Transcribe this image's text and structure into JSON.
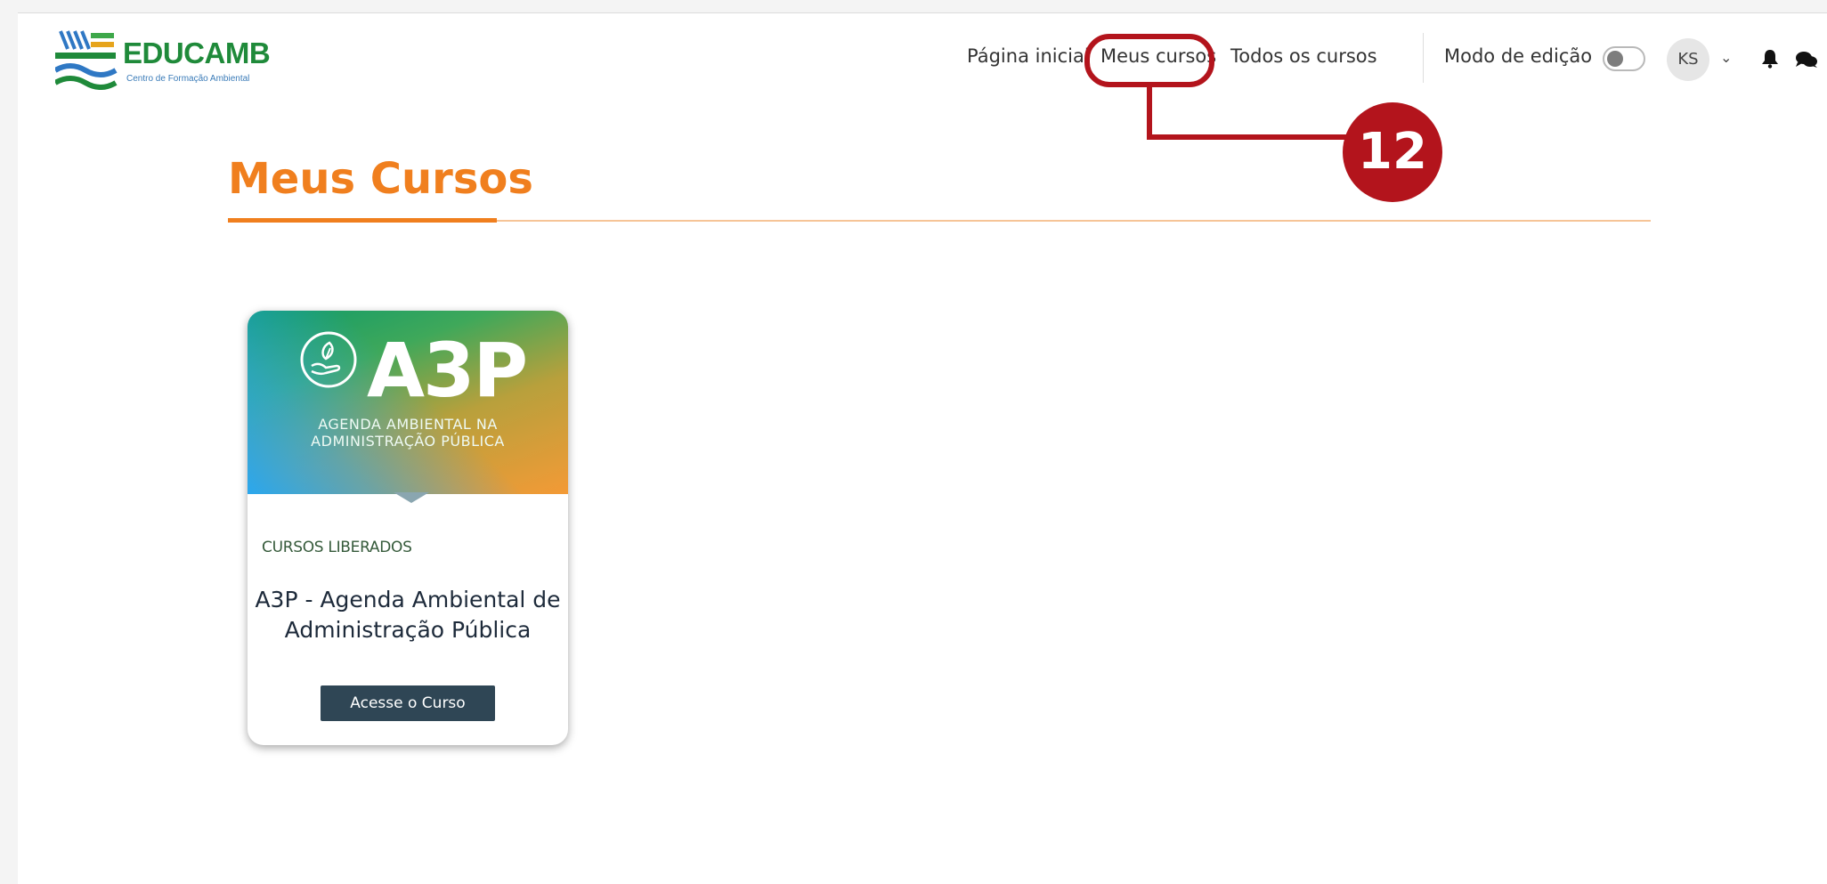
{
  "brand": {
    "name": "EDUCAMB",
    "subtitle": "Centro de Formação Ambiental"
  },
  "nav": {
    "items": [
      {
        "label": "Página inicial"
      },
      {
        "label": "Meus cursos"
      },
      {
        "label": "Todos os cursos"
      }
    ]
  },
  "edit_mode": {
    "label": "Modo de edição",
    "enabled": false
  },
  "user": {
    "initials": "KS"
  },
  "annotation": {
    "number": "12"
  },
  "page": {
    "title": "Meus Cursos"
  },
  "courses": [
    {
      "banner_code": "A3P",
      "banner_subtitle_line1": "AGENDA AMBIENTAL NA",
      "banner_subtitle_line2": "ADMINISTRAÇÃO PÚBLICA",
      "category": "CURSOS LIBERADOS",
      "title_line1": "A3P - Agenda Ambiental de",
      "title_line2": "Administração Pública",
      "button_label": "Acesse o Curso"
    }
  ],
  "icons": [
    "chevron-down-icon",
    "bell-icon",
    "chat-icon",
    "leaf-hand-icon"
  ],
  "colors": {
    "brand_green": "#1f8a3a",
    "accent_orange": "#f07f1e",
    "annotation_red": "#b3141c",
    "button_dark": "#2f4655"
  }
}
